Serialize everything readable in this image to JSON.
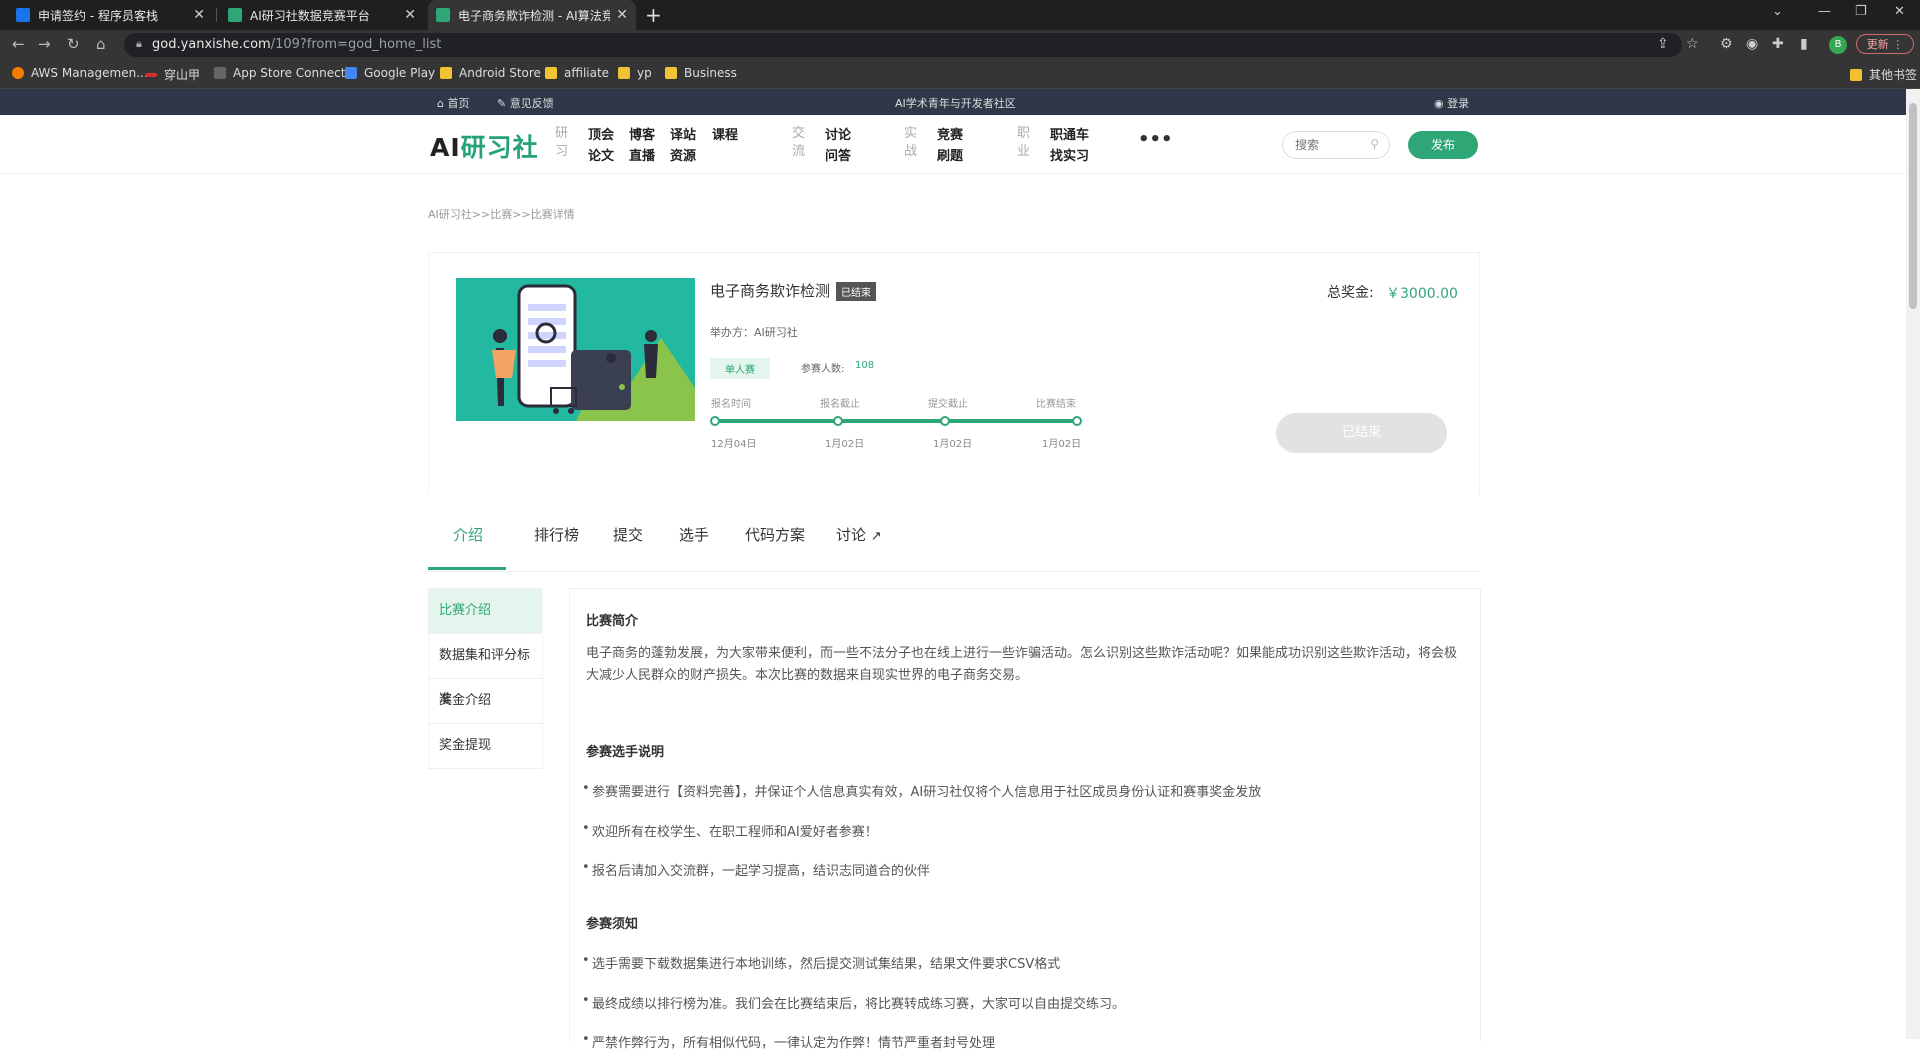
{
  "browser": {
    "tabs": [
      {
        "title": "申请签约 - 程序员客栈"
      },
      {
        "title": "AI研习社数据竞赛平台"
      },
      {
        "title": "电子商务欺诈检测 - AI算法竞赛"
      }
    ],
    "url_host": "god.yanxishe.com",
    "url_path": "/109?from=god_home_list",
    "update_label": "更新",
    "profile_initial": "B",
    "bookmarks": [
      "AWS Managemen...",
      "穿山甲",
      "App Store Connect",
      "Google Play",
      "Android Store",
      "affiliate",
      "yp",
      "Business"
    ],
    "other_bookmarks": "其他书签"
  },
  "sitebar": {
    "home": "首页",
    "feedback": "意见反馈",
    "slogan": "AI学术青年与开发者社区",
    "login": "登录"
  },
  "header": {
    "logo_ai": "AI",
    "logo_cn": "研习社",
    "groups": [
      {
        "cat": "研习",
        "cols": [
          [
            "顶会",
            "论文"
          ],
          [
            "博客",
            "直播"
          ],
          [
            "译站",
            "资源"
          ],
          [
            "课程",
            ""
          ]
        ]
      },
      {
        "cat": "交流",
        "cols": [
          [
            "讨论",
            "问答"
          ]
        ]
      },
      {
        "cat": "实战",
        "cols": [
          [
            "竞赛",
            "刷题"
          ]
        ]
      },
      {
        "cat": "职业",
        "cols": [
          [
            "职通车",
            "找实习"
          ]
        ]
      }
    ],
    "more": "•••",
    "search_placeholder": "搜索",
    "publish": "发布"
  },
  "breadcrumb": "AI研习社>>比赛>>比赛详情",
  "competition": {
    "title": "电子商务欺诈检测",
    "status_badge": "已结束",
    "host": "举办方：AI研习社",
    "type": "单人赛",
    "participants_label": "参赛人数:",
    "participants": "108",
    "prize_label": "总奖金:",
    "prize_value": "￥3000.00",
    "ended_button": "已结束",
    "timeline": [
      {
        "label": "报名时间",
        "date": "12月04日"
      },
      {
        "label": "报名截止",
        "date": "1月02日"
      },
      {
        "label": "提交截止",
        "date": "1月02日"
      },
      {
        "label": "比赛结束",
        "date": "1月02日"
      }
    ]
  },
  "tabs": [
    "介绍",
    "排行榜",
    "提交",
    "选手",
    "代码方案",
    "讨论"
  ],
  "sidebar": [
    "比赛介绍",
    "数据集和评分标准",
    "奖金介绍",
    "奖金提现"
  ],
  "content": {
    "intro_title": "比赛简介",
    "intro_text": "电子商务的蓬勃发展，为大家带来便利，而一些不法分子也在线上进行一些诈骗活动。怎么识别这些欺诈活动呢？如果能成功识别这些欺诈活动，将会极大减少人民群众的财产损失。本次比赛的数据来自现实世界的电子商务交易。",
    "notes_title": "参赛选手说明",
    "notes": [
      "参赛需要进行【资料完善】，并保证个人信息真实有效，AI研习社仅将个人信息用于社区成员身份认证和赛事奖金发放",
      "欢迎所有在校学生、在职工程师和AI爱好者参赛！",
      "报名后请加入交流群，一起学习提高，结识志同道合的伙伴"
    ],
    "rules_title": "参赛须知",
    "rules": [
      "选手需要下载数据集进行本地训练，然后提交测试集结果，结果文件要求CSV格式",
      "最终成绩以排行榜为准。我们会在比赛结束后，将比赛转成练习赛，大家可以自由提交练习。",
      "严禁作弊行为，所有相似代码，一律认定为作弊！情节严重者封号处理"
    ]
  }
}
